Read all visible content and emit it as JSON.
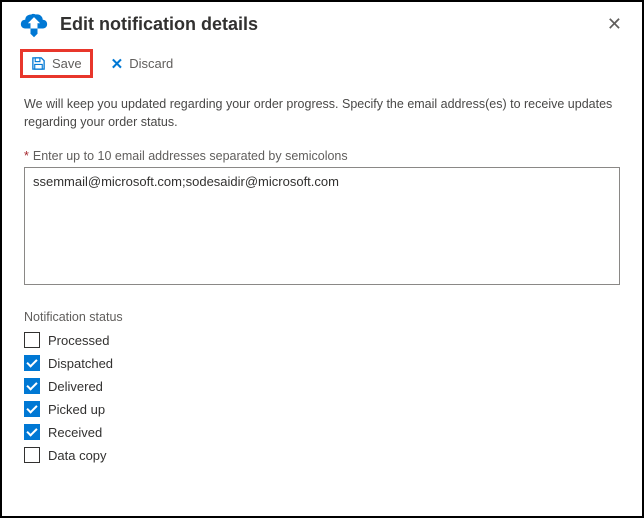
{
  "header": {
    "title": "Edit notification details"
  },
  "toolbar": {
    "save_label": "Save",
    "discard_label": "Discard"
  },
  "description": "We will keep you updated regarding your order progress. Specify the email address(es) to receive updates regarding your order status.",
  "email_field": {
    "label": "Enter up to 10 email addresses separated by semicolons",
    "value": "ssemmail@microsoft.com;sodesaidir@microsoft.com"
  },
  "status_section": {
    "label": "Notification status",
    "items": [
      {
        "label": "Processed",
        "checked": false
      },
      {
        "label": "Dispatched",
        "checked": true
      },
      {
        "label": "Delivered",
        "checked": true
      },
      {
        "label": "Picked up",
        "checked": true
      },
      {
        "label": "Received",
        "checked": true
      },
      {
        "label": "Data copy",
        "checked": false
      }
    ]
  }
}
